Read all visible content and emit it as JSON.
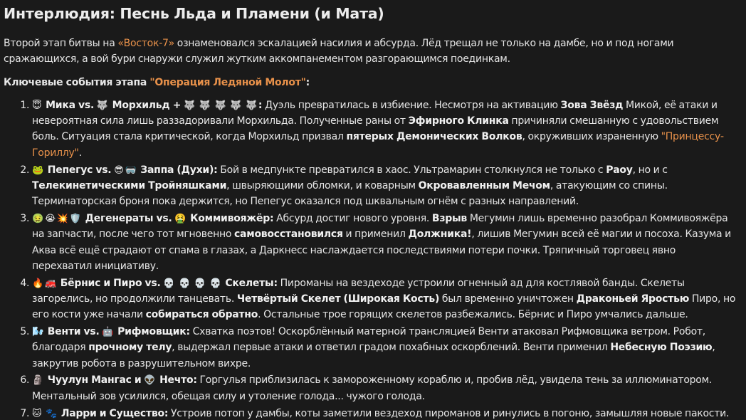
{
  "title": "Интерлюдия: Песнь Льда и Пламени (и Мата)",
  "intro": {
    "pre": "Второй этап битвы на ",
    "location": "«Восток-7»",
    "post": " ознаменовался эскалацией насилия и абсурда. Лёд трещал не только на дамбе, но и под ногами сражающихся, а вой бури снаружи служил жутким аккомпанементом разгорающимся поединкам."
  },
  "events_heading": {
    "pre": "Ключевые события этапа ",
    "operation": "\"Операция Ледяной Молот\"",
    "post": ":"
  },
  "events": [
    {
      "icons": [
        "😇"
      ],
      "title_a": "Мика vs.",
      "icons_b": [
        "🐺"
      ],
      "title_b": "Морхильд +",
      "icons_c": [
        "🐺",
        "🐺",
        "🐺",
        "🐺",
        "🐺"
      ],
      "title_c": ":",
      "t1": " Дуэль превратилась в избиение. Несмотря на активацию ",
      "b1": "Зова Звёзд",
      "t2": " Микой, её атаки и невероятная сила лишь раззадоривали Морхильда. Полученные раны от ",
      "b2": "Эфирного Клинка",
      "t3": " причиняли смешанную с удовольствием боль. Ситуация стала критической, когда Морхильд призвал ",
      "b3": "пятерых Демонических Волков",
      "t4": ", окруживших израненную ",
      "hl": "\"Принцессу-Гориллу\"",
      "t5": "."
    },
    {
      "icons": [
        "🐸"
      ],
      "title_a": "Пепегус vs.",
      "icons_b": [
        "😎",
        "🥽"
      ],
      "title_b": "Заппа (Духи):",
      "t1": " Бой в медпункте превратился в хаос. Ультрамарин столкнулся не только с ",
      "b1": "Раоу",
      "t2": ", но и с ",
      "b2": "Телекинетическими Тройняшками",
      "t3": ", швыряющими обломки, и коварным ",
      "b3": "Окровавленным Мечом",
      "t4": ", атакующим со спины. Терминаторская броня пока держится, но Пепегус оказался под шквальным огнём с разных направлений."
    },
    {
      "icons": [
        "🤢",
        "😭",
        "💥",
        "🛡️"
      ],
      "title_a": "Дегенераты vs.",
      "icons_b": [
        "🤮"
      ],
      "title_b": "Коммивояжёр:",
      "t1": " Абсурд достиг нового уровня. ",
      "b1": "Взрыв",
      "t2": " Мегумин лишь временно разобрал Коммивояжёра на запчасти, после чего тот мгновенно ",
      "b2": "самовосстановился",
      "t3": " и применил ",
      "b3": "Должника!",
      "t4": ", лишив Мегумин всей её магии и посоха. Казума и Аква всё ещё страдают от спама в глазах, а Даркнесс наслаждается последствиями потери почки. Тряпичный торговец явно перехватил инициативу."
    },
    {
      "icons": [
        "🔥",
        "🚒"
      ],
      "title_a": "Бёрнис и Пиро vs.",
      "icons_b": [
        "💀",
        "💀",
        "💀",
        "💀"
      ],
      "title_b": "Скелеты:",
      "t1": " Пироманы на вездеходе устроили огненный ад для костлявой банды. Скелеты загорелись, но продолжили танцевать. ",
      "b1": "Четвёртый Скелет (Широкая Кость)",
      "t2": " был временно уничтожен ",
      "b2": "Драконьей Яростью",
      "t3": " Пиро, но его кости уже начали ",
      "b3": "собираться обратно",
      "t4": ". Остальные трое горящих скелетов разбежались. Бёрнис и Пиро умчались дальше."
    },
    {
      "icons": [
        "🌬️"
      ],
      "title_a": "Венти vs.",
      "icons_b": [
        "🤖"
      ],
      "title_b": "Рифмовщик:",
      "t1": " Схватка поэтов! Оскорблённый матерной трансляцией Венти атаковал Рифмовщика ветром. Робот, благодаря ",
      "b1": "прочному телу",
      "t2": ", выдержал первые атаки и ответил градом похабных оскорблений. Венти применил ",
      "b2": "Небесную Поэзию",
      "t3": ", закрутив робота в разрушительном вихре."
    },
    {
      "icons": [
        "🗿"
      ],
      "title_a": "Чуулун Мангас и",
      "icons_b": [
        "👽"
      ],
      "title_b": "Нечто:",
      "t1": " Горгулья приблизилась к замороженному кораблю и, пробив лёд, увидела тень за иллюминатором. Ментальный зов усилился, обещая силу и утоление голода... чужого голода."
    },
    {
      "icons": [
        "🐱",
        "🐾"
      ],
      "title_a": "Ларри и Существо:",
      "t1": " Устроив потоп у дамбы, коты заметили вездеход пироманов и ринулись в погоню, замышляя новые пакости."
    }
  ]
}
